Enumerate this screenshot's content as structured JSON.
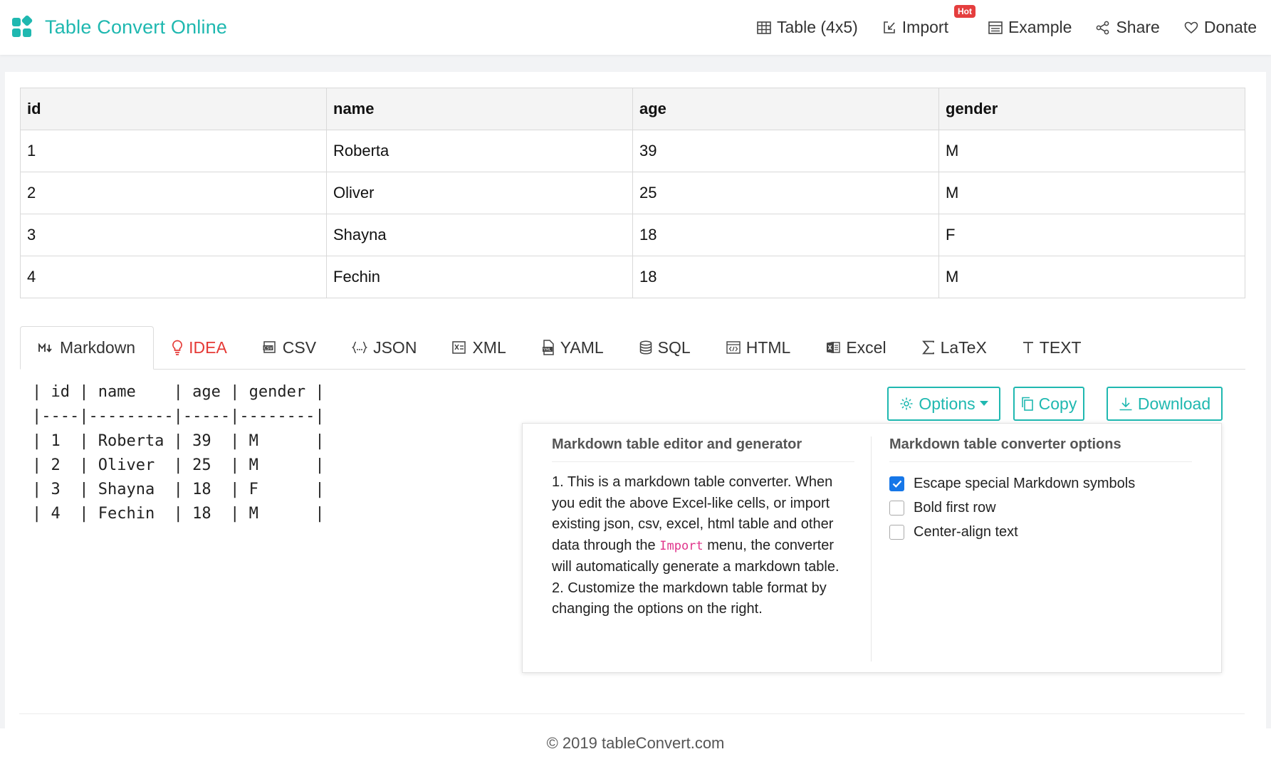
{
  "header": {
    "brand_title": "Table Convert Online",
    "brand_color": "#1fb8b0",
    "nav": [
      {
        "label": "Table (4x5)",
        "icon": "table-icon"
      },
      {
        "label": "Import",
        "icon": "import-icon",
        "badge": "Hot"
      },
      {
        "label": "Example",
        "icon": "example-icon"
      },
      {
        "label": "Share",
        "icon": "share-icon"
      },
      {
        "label": "Donate",
        "icon": "heart-icon"
      }
    ]
  },
  "table": {
    "headers": [
      "id",
      "name",
      "age",
      "gender"
    ],
    "rows": [
      [
        "1",
        "Roberta",
        "39",
        "M"
      ],
      [
        "2",
        "Oliver",
        "25",
        "M"
      ],
      [
        "3",
        "Shayna",
        "18",
        "F"
      ],
      [
        "4",
        "Fechin",
        "18",
        "M"
      ]
    ]
  },
  "tabs": [
    {
      "label": "Markdown",
      "icon": "markdown-icon",
      "active": true
    },
    {
      "label": "IDEA",
      "icon": "lightbulb-icon"
    },
    {
      "label": "CSV",
      "icon": "csv-icon"
    },
    {
      "label": "JSON",
      "icon": "json-icon"
    },
    {
      "label": "XML",
      "icon": "xml-icon"
    },
    {
      "label": "YAML",
      "icon": "yaml-icon"
    },
    {
      "label": "SQL",
      "icon": "database-icon"
    },
    {
      "label": "HTML",
      "icon": "html-icon"
    },
    {
      "label": "Excel",
      "icon": "excel-icon"
    },
    {
      "label": "LaTeX",
      "icon": "sigma-icon"
    },
    {
      "label": "TEXT",
      "icon": "text-icon"
    }
  ],
  "output": {
    "lines": [
      "| id | name    | age | gender |",
      "|----|---------|-----|--------|",
      "| 1  | Roberta | 39  | M      |",
      "| 2  | Oliver  | 25  | M      |",
      "| 3  | Shayna  | 18  | F      |",
      "| 4  | Fechin  | 18  | M      |"
    ]
  },
  "actions": {
    "options_label": "Options",
    "copy_label": "Copy",
    "download_label": "Download"
  },
  "panel": {
    "left_title": "Markdown table editor and generator",
    "para1_before": "1. This is a markdown table converter. When you edit the above Excel-like cells, or import existing json, csv, excel, html table and other data through the ",
    "para1_keyword": "Import",
    "para1_after": " menu, the converter will automatically generate a markdown table.",
    "para2": "2. Customize the markdown table format by changing the options on the right.",
    "right_title": "Markdown table converter options",
    "options": [
      {
        "label": "Escape special Markdown symbols",
        "checked": true
      },
      {
        "label": "Bold first row",
        "checked": false
      },
      {
        "label": "Center-align text",
        "checked": false
      }
    ]
  },
  "footer": {
    "text": "© 2019 tableConvert.com"
  }
}
